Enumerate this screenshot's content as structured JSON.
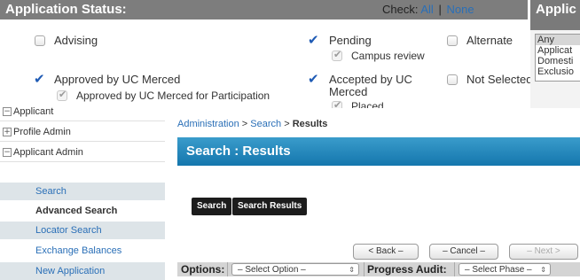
{
  "status_panel": {
    "title": "Application Status:",
    "check_label": "Check:",
    "check_all": "All",
    "check_sep": "|",
    "check_none": "None",
    "options": [
      {
        "label": "Advising",
        "checked": false
      },
      {
        "label": "Pending",
        "checked": true,
        "sub": "Campus review"
      },
      {
        "label": "Alternate",
        "checked": false
      },
      {
        "label": "Approved by UC Merced",
        "checked": true,
        "sub": "Approved by UC Merced for Participation"
      },
      {
        "label_line1": "Accepted by UC",
        "label_line2": "Merced",
        "checked": true,
        "sub": "Placed"
      },
      {
        "label": "Not Selected",
        "checked": false
      }
    ]
  },
  "side_box": {
    "title": "Applic",
    "items": [
      "Any",
      "Applicat",
      "Domesti",
      "Exclusio"
    ]
  },
  "sidebar": {
    "items": [
      {
        "label": "Applicant",
        "icon": "−"
      },
      {
        "label": "Profile Admin",
        "icon": "+"
      },
      {
        "label": "Applicant Admin",
        "icon": "−"
      },
      {
        "label": "Search"
      },
      {
        "label": "Advanced Search"
      },
      {
        "label": "Locator Search"
      },
      {
        "label": "Exchange Balances"
      },
      {
        "label": "New Application"
      }
    ]
  },
  "main": {
    "breadcrumb": {
      "part1": "Administration",
      "arrow": ">",
      "part2": "Search",
      "current": "Results"
    },
    "title": "Search : Results",
    "buttons": {
      "search": "Search",
      "search_results": "Search Results"
    },
    "nav": {
      "back": "< Back –",
      "cancel": "– Cancel –",
      "next": "– Next >"
    },
    "options_label": "Options:",
    "options_select": "– Select Option –",
    "audit_label": "Progress Audit:",
    "audit_select": "– Select Phase –"
  }
}
